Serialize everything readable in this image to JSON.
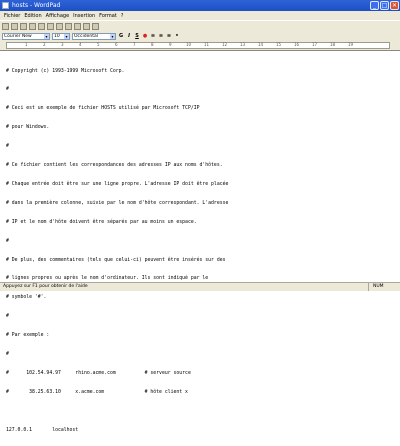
{
  "window": {
    "title": "hosts - WordPad"
  },
  "menu": {
    "items": [
      "Fichier",
      "Edition",
      "Affichage",
      "Insertion",
      "Format",
      "?"
    ]
  },
  "format": {
    "font": "Courier New",
    "size": "10",
    "script": "Occidental"
  },
  "document": {
    "lines": [
      "# Copyright (c) 1993-1999 Microsoft Corp.",
      "#",
      "# Ceci est un exemple de fichier HOSTS utilisé par Microsoft TCP/IP",
      "# pour Windows.",
      "#",
      "# Ce fichier contient les correspondances des adresses IP aux noms d'hôtes.",
      "# Chaque entrée doit être sur une ligne propre. L'adresse IP doit être placée",
      "# dans la première colonne, suivie par le nom d'hôte correspondant. L'adresse",
      "# IP et le nom d'hôte doivent être séparés par au moins un espace.",
      "#",
      "# De plus, des commentaires (tels que celui-ci) peuvent être insérés sur des",
      "# lignes propres ou après le nom d'ordinateur. Ils sont indiqué par le",
      "# symbole '#'.",
      "#",
      "# Par exemple :",
      "#",
      "#      102.54.94.97     rhino.acme.com          # serveur source",
      "#       38.25.63.10     x.acme.com              # hôte client x",
      "",
      "127.0.0.1       localhost"
    ]
  },
  "status": {
    "help": "Appuyez sur F1 pour obtenir de l'aide",
    "num": "NUM"
  },
  "ruler": {
    "ticks": [
      "1",
      "2",
      "3",
      "4",
      "5",
      "6",
      "7",
      "8",
      "9",
      "10",
      "11",
      "12",
      "13",
      "14",
      "15",
      "16",
      "17",
      "18",
      "19"
    ]
  }
}
